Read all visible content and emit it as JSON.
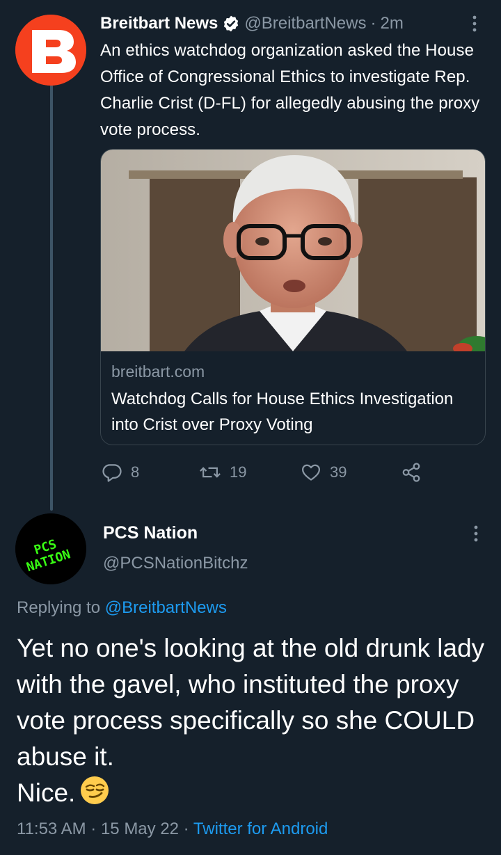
{
  "tweet": {
    "author": "Breitbart News",
    "handle": "@BreitbartNews",
    "separator": "·",
    "time": "2m",
    "text": "An ethics watchdog organization asked the House Office of Congressional Ethics to investigate Rep. Charlie Crist (D-FL) for allegedly abusing the proxy vote process.",
    "card": {
      "domain": "breitbart.com",
      "title": "Watchdog Calls for House Ethics Investigation into Crist over Proxy Voting"
    },
    "actions": {
      "replies": "8",
      "retweets": "19",
      "likes": "39"
    }
  },
  "reply": {
    "author": "PCS Nation",
    "handle": "@PCSNationBitchz",
    "replying_prefix": "Replying to",
    "replying_to": "@BreitbartNews",
    "text": "Yet no one's looking at the old drunk lady with the gavel, who instituted the proxy vote process specifically so she COULD abuse it.",
    "text_line2": "Nice.",
    "emoji": "smirking-face",
    "avatar_text_1": "PCS",
    "avatar_text_2": "NATION",
    "timestamp": "11:53 AM · 15 May 22 ·",
    "source": "Twitter for Android"
  },
  "colors": {
    "background": "#15202b",
    "primary_text": "#ffffff",
    "secondary_text": "#8b98a5",
    "accent": "#1d9bf0",
    "breitbart_orange": "#f5401e",
    "pcs_green": "#39ff14"
  }
}
